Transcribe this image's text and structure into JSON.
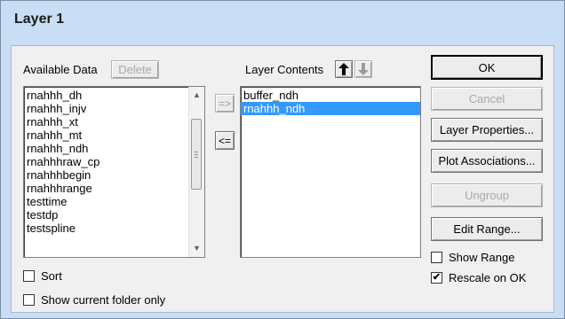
{
  "window": {
    "title": "Layer 1"
  },
  "available": {
    "label": "Available Data",
    "delete_label": "Delete",
    "items": [
      "rnahhh_dh",
      "rnahhh_injv",
      "rnahhh_xt",
      "rnahhh_mt",
      "rnahhh_ndh",
      "rnahhhraw_cp",
      "rnahhhbegin",
      "rnahhhrange",
      "testtime",
      "testdp",
      "testspline"
    ]
  },
  "transfer": {
    "add_label": "=>",
    "remove_label": "<="
  },
  "layer_contents": {
    "label": "Layer Contents",
    "items": [
      "buffer_ndh",
      "rnahhh_ndh"
    ],
    "selected_index": 1
  },
  "buttons": {
    "ok": "OK",
    "cancel": "Cancel",
    "layer_properties": "Layer Properties...",
    "plot_associations": "Plot Associations...",
    "ungroup": "Ungroup",
    "edit_range": "Edit Range..."
  },
  "checkboxes": {
    "sort": {
      "label": "Sort",
      "checked": false
    },
    "show_current_folder": {
      "label": "Show current folder only",
      "checked": false
    },
    "show_range": {
      "label": "Show Range",
      "checked": false
    },
    "rescale_on_ok": {
      "label": "Rescale on OK",
      "checked": true
    }
  },
  "icons": {
    "move_up": "arrow-up-icon",
    "move_down": "arrow-down-icon"
  }
}
